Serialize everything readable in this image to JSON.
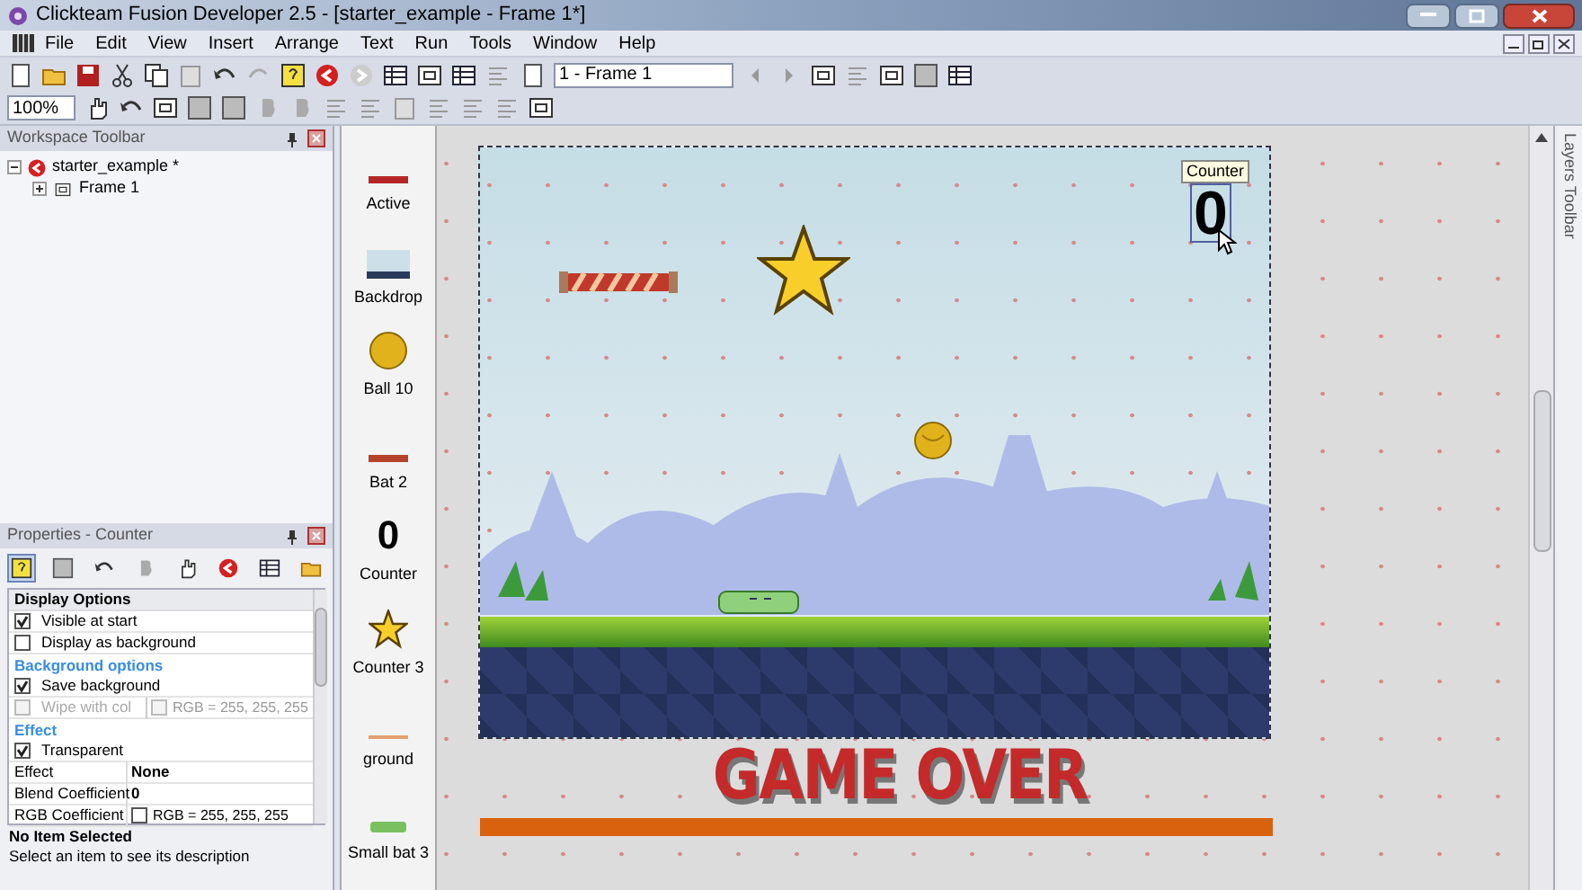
{
  "window": {
    "title": "Clickteam Fusion Developer 2.5 - [starter_example - Frame 1*]"
  },
  "menu": [
    "File",
    "Edit",
    "View",
    "Insert",
    "Arrange",
    "Text",
    "Run",
    "Tools",
    "Window",
    "Help"
  ],
  "toolbar": {
    "frame_select": "1 - Frame 1",
    "zoom": "100%"
  },
  "workspace": {
    "title": "Workspace Toolbar",
    "tree": [
      {
        "label": "starter_example *",
        "expanded": true,
        "children": [
          {
            "label": "Frame 1",
            "expanded": false
          }
        ]
      }
    ]
  },
  "properties": {
    "title": "Properties - Counter",
    "tabs": [
      {
        "selected": true
      },
      {
        "selected": false
      },
      {
        "selected": false
      },
      {
        "selected": false
      },
      {
        "selected": false
      },
      {
        "selected": false
      },
      {
        "selected": false
      },
      {
        "selected": false
      }
    ],
    "rows": [
      {
        "kind": "header",
        "label": "Display Options"
      },
      {
        "kind": "checkbox",
        "label": "Visible at start",
        "checked": true,
        "disabled": false
      },
      {
        "kind": "checkbox",
        "label": "Display as background",
        "checked": false,
        "disabled": false
      },
      {
        "kind": "section",
        "label": "Background options"
      },
      {
        "kind": "checkbox",
        "label": "Save background",
        "checked": true,
        "disabled": false
      },
      {
        "kind": "checkbox",
        "label": "Wipe with col",
        "checked": false,
        "disabled": true,
        "value": "RGB = 255, 255, 255",
        "color_checked": false
      },
      {
        "kind": "section",
        "label": "Effect"
      },
      {
        "kind": "checkbox",
        "label": "Transparent",
        "checked": true,
        "disabled": false
      },
      {
        "kind": "value",
        "label": "Effect",
        "value": "None"
      },
      {
        "kind": "value",
        "label": "Blend Coefficient",
        "value": "0"
      },
      {
        "kind": "color",
        "label": "RGB Coefficient",
        "value": "RGB = 255, 255, 255",
        "color_checked": false
      }
    ],
    "description": {
      "title": "No Item Selected",
      "text": "Select an item to see its description"
    }
  },
  "objects": [
    {
      "kind": "active",
      "label": "Active"
    },
    {
      "kind": "backdrop",
      "label": "Backdrop"
    },
    {
      "kind": "ball",
      "label": "Ball 10"
    },
    {
      "kind": "bat",
      "label": "Bat 2"
    },
    {
      "kind": "counter",
      "label": "Counter",
      "digit": "0"
    },
    {
      "kind": "star",
      "label": "Counter 3"
    },
    {
      "kind": "line",
      "label": "ground"
    },
    {
      "kind": "smallbat",
      "label": "Small bat 3"
    }
  ],
  "frame": {
    "tooltip": "Counter",
    "counter": "0",
    "game_over": "GAME OVER"
  },
  "layers_toolbar": "Layers Toolbar"
}
